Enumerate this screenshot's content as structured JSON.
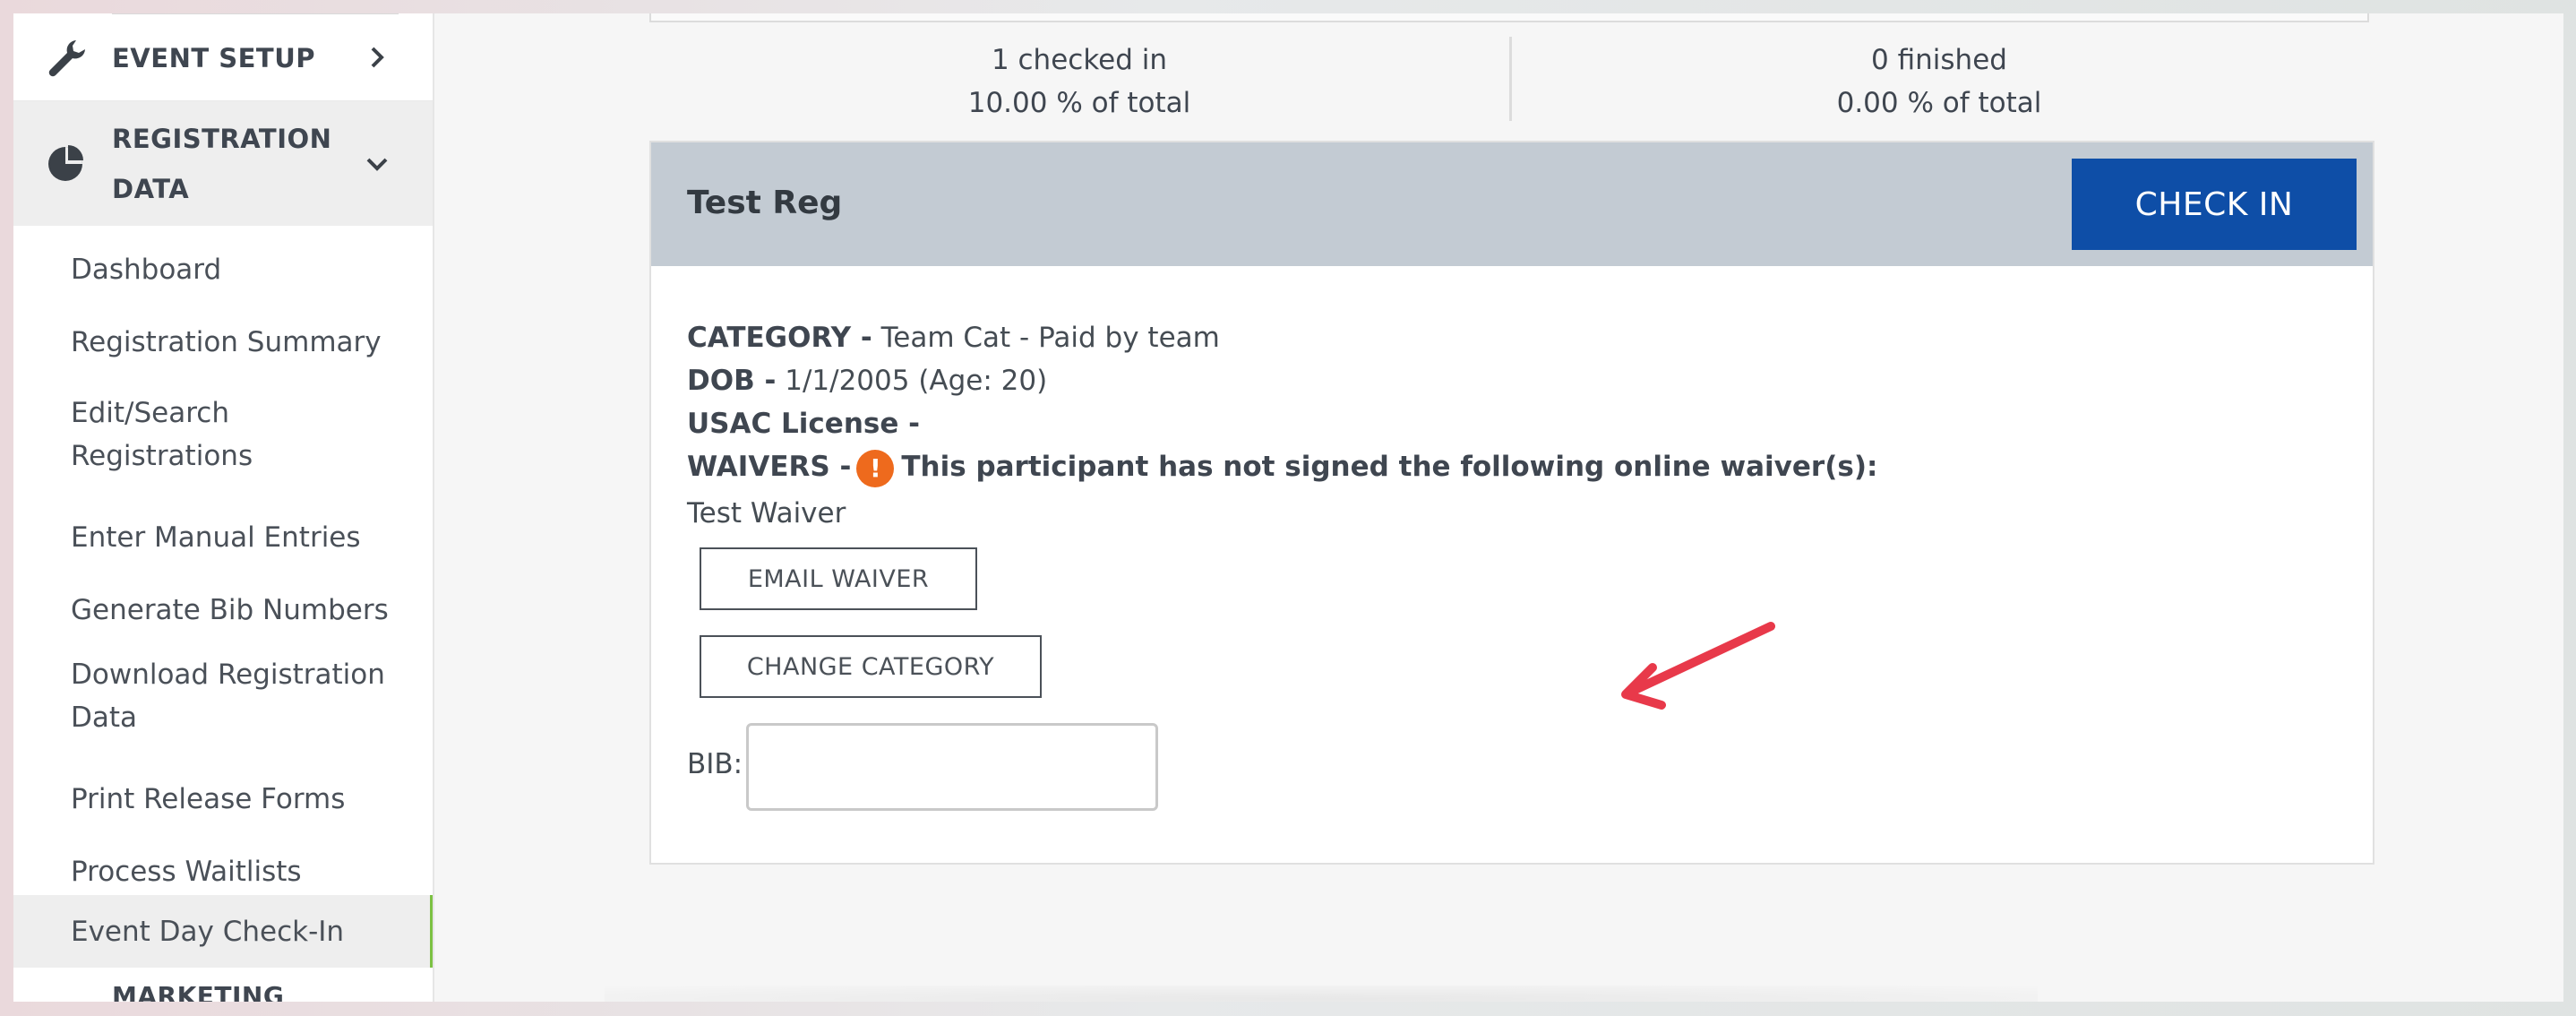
{
  "sidebar": {
    "event_setup_label": "EVENT SETUP",
    "registration_data_label_line1": "REGISTRATION",
    "registration_data_label_line2": "DATA",
    "items": [
      {
        "label": "Dashboard"
      },
      {
        "label": "Registration Summary"
      },
      {
        "label": "Edit/Search"
      },
      {
        "label": "Registrations"
      },
      {
        "label": "Enter Manual Entries"
      },
      {
        "label": "Generate Bib Numbers"
      },
      {
        "label": "Download Registration"
      },
      {
        "label": "Data"
      },
      {
        "label": "Print Release Forms"
      },
      {
        "label": "Process Waitlists"
      },
      {
        "label": "Event Day Check-In"
      }
    ],
    "marketing_label": "MARKETING",
    "active_accent": "#7cc143"
  },
  "stats": {
    "checked_in": "1 checked in",
    "checked_in_pct": "10.00 % of total",
    "finished": "0 finished",
    "finished_pct": "0.00 % of total"
  },
  "registrant": {
    "name": "Test Reg",
    "check_in_label": "CHECK IN",
    "category_label": "CATEGORY -",
    "category_value": "Team Cat - Paid by team",
    "dob_label": "DOB -",
    "dob_value": "1/1/2005 (Age: 20)",
    "license_label": "USAC License -",
    "waivers_label": "WAIVERS -",
    "waiver_warning": "This participant has not signed the following online waiver(s):",
    "waiver_name": "Test Waiver",
    "email_waiver_label": "EMAIL WAIVER",
    "change_category_label": "CHANGE CATEGORY",
    "bib_label": "BIB:",
    "bib_value": ""
  },
  "colors": {
    "primary_button": "#0e4ea7",
    "card_header": "#c3cbd3",
    "warning": "#ee6a1d",
    "annotation_arrow": "#e8394a"
  },
  "icons": {
    "event_setup": "wrench-icon",
    "registration_data": "pie-chart-icon",
    "warning": "exclamation-circle-icon"
  }
}
